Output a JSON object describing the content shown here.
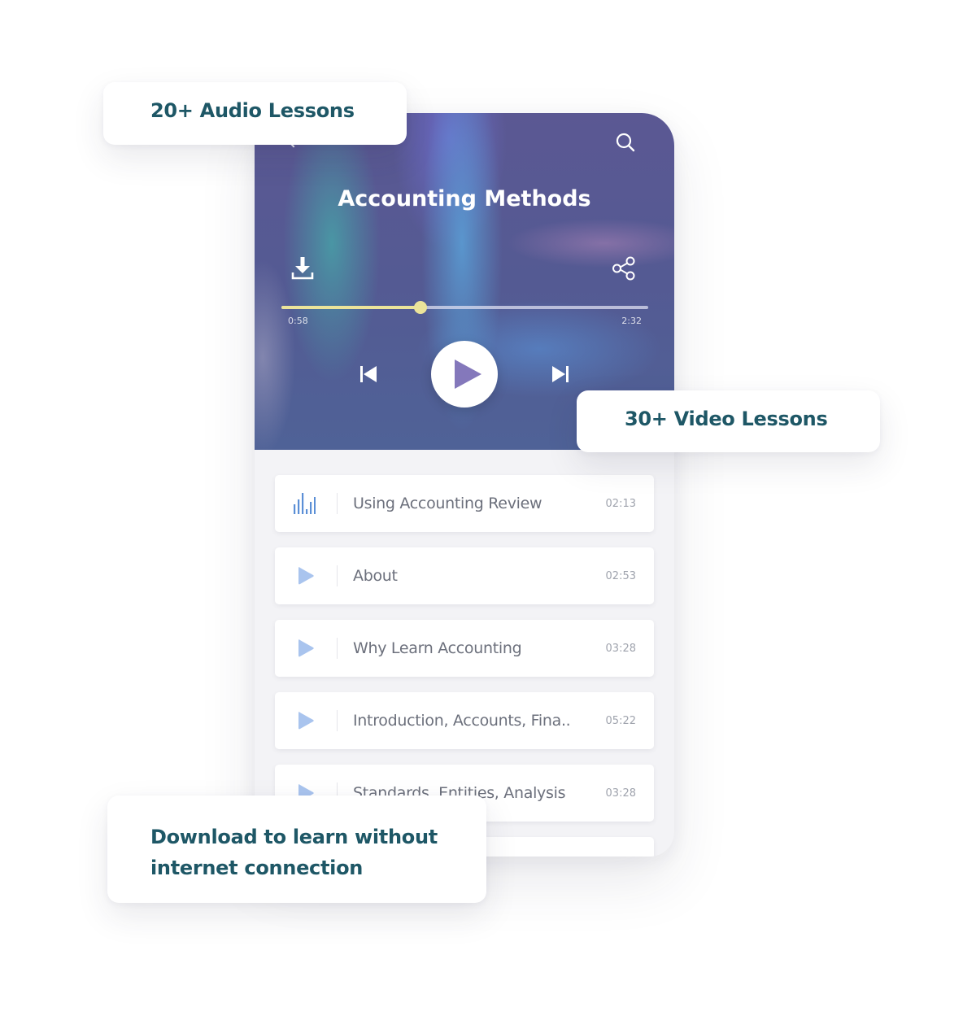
{
  "player": {
    "title": "Accounting Methods",
    "elapsed": "0:58",
    "total": "2:32",
    "progress_fraction": 0.38,
    "accent_color": "#ece49a",
    "play_color": "#8478bb",
    "icons": {
      "back": "chevron-left-icon",
      "search": "search-icon",
      "download": "download-icon",
      "share": "share-icon",
      "previous": "skip-previous-icon",
      "play": "play-icon",
      "next": "skip-next-icon"
    }
  },
  "lessons": [
    {
      "title": "Using Accounting Review",
      "duration": "02:13",
      "icon": "equalizer-icon",
      "state": "playing"
    },
    {
      "title": "About",
      "duration": "02:53",
      "icon": "play-icon"
    },
    {
      "title": "Why Learn Accounting",
      "duration": "03:28",
      "icon": "play-icon"
    },
    {
      "title": "Introduction, Accounts, Fina..",
      "duration": "05:22",
      "icon": "play-icon"
    },
    {
      "title": "Standards, Entities, Analysis",
      "duration": "03:28",
      "icon": "play-icon"
    }
  ],
  "callouts": {
    "audio": "20+ Audio Lessons",
    "video": "30+ Video Lessons",
    "offline": "Download to learn without internet connection"
  },
  "colors": {
    "callout_text": "#1e5766",
    "lesson_icon": "#a9c4ee",
    "equalizer": "#5b8fd6"
  }
}
